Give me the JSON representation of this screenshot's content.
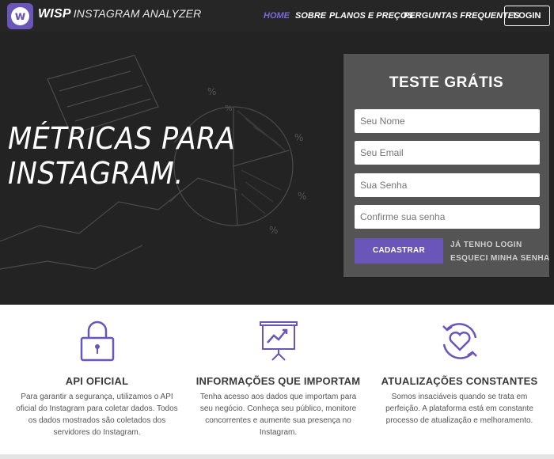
{
  "brand": {
    "logo_letter": "w",
    "name_bold": "WISP",
    "name_sub": "INSTAGRAM ANALYZER",
    "accent_color": "#6a55b8"
  },
  "nav": {
    "items": [
      {
        "label": "HOME",
        "active": true
      },
      {
        "label": "SOBRE",
        "active": false
      },
      {
        "label": "PLANOS E PREÇOS",
        "active": false
      },
      {
        "label": "PERGUNTAS FREQUENTES",
        "active": false
      }
    ],
    "login_label": "LOGIN"
  },
  "hero": {
    "title_line1": "MÉTRICAS PARA",
    "title_line2": "INSTAGRAM."
  },
  "signup": {
    "title": "TESTE GRÁTIS",
    "placeholders": {
      "name": "Seu Nome",
      "email": "Seu Email",
      "password": "Sua Senha",
      "confirm": "Confirme sua senha"
    },
    "submit_label": "CADASTRAR",
    "login_link": "JÁ TENHO LOGIN",
    "forgot_link": "ESQUECI MINHA SENHA"
  },
  "features": [
    {
      "icon": "lock-icon",
      "title": "API OFICIAL",
      "text": "Para garantir a segurança, utilizamos o API oficial do Instagram para coletar dados. Todos os dados mostrados são coletados dos servidores do Instagram."
    },
    {
      "icon": "presentation-chart-icon",
      "title": "INFORMAÇÕES QUE IMPORTAM",
      "text": "Tenha acesso aos dados que importam para seu negócio. Conheça seu público, monitore concorrentes e aumente sua presença no Instagram."
    },
    {
      "icon": "heart-refresh-icon",
      "title": "ATUALIZAÇÕES CONSTANTES",
      "text": "Somos insaciáveis quando se trata em perfeição. A plataforma está em constante processo de atualização e melhoramento."
    }
  ]
}
